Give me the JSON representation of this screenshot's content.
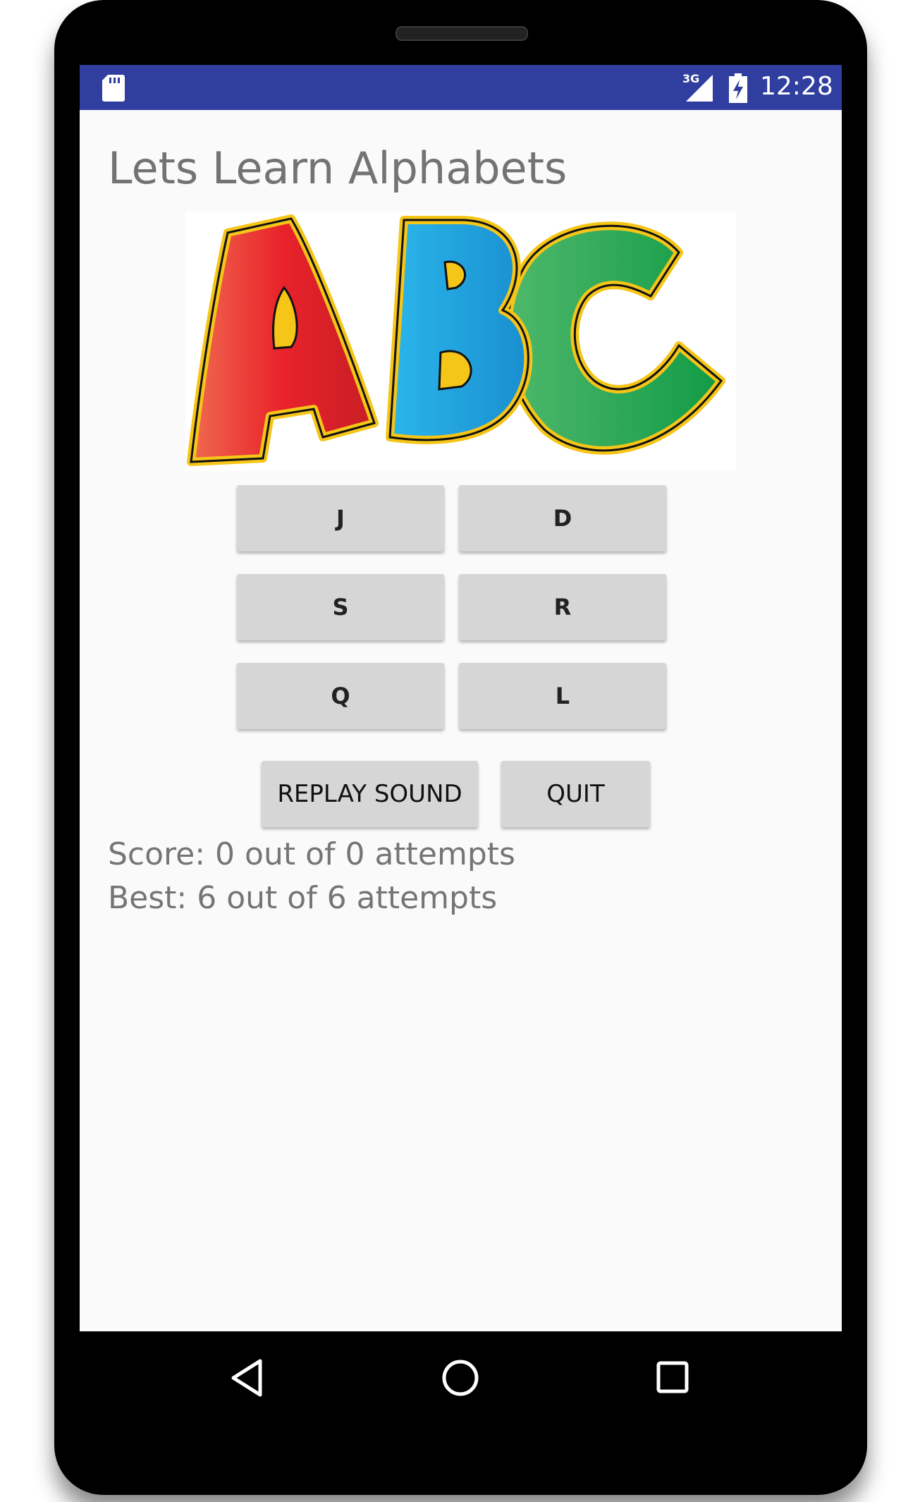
{
  "status_bar": {
    "network": "3G",
    "time": "12:28",
    "color": "#303f9f"
  },
  "app": {
    "title": "Lets Learn Alphabets",
    "image_letters": [
      "A",
      "B",
      "C"
    ],
    "letter_buttons": [
      "J",
      "D",
      "S",
      "R",
      "Q",
      "L"
    ],
    "replay_label": "REPLAY SOUND",
    "quit_label": "QUIT",
    "score_text": "Score: 0 out of 0 attempts",
    "best_text": "Best: 6 out of 6 attempts"
  },
  "nav_bar": {
    "icons": [
      "back-icon",
      "home-icon",
      "recent-apps-icon"
    ]
  }
}
